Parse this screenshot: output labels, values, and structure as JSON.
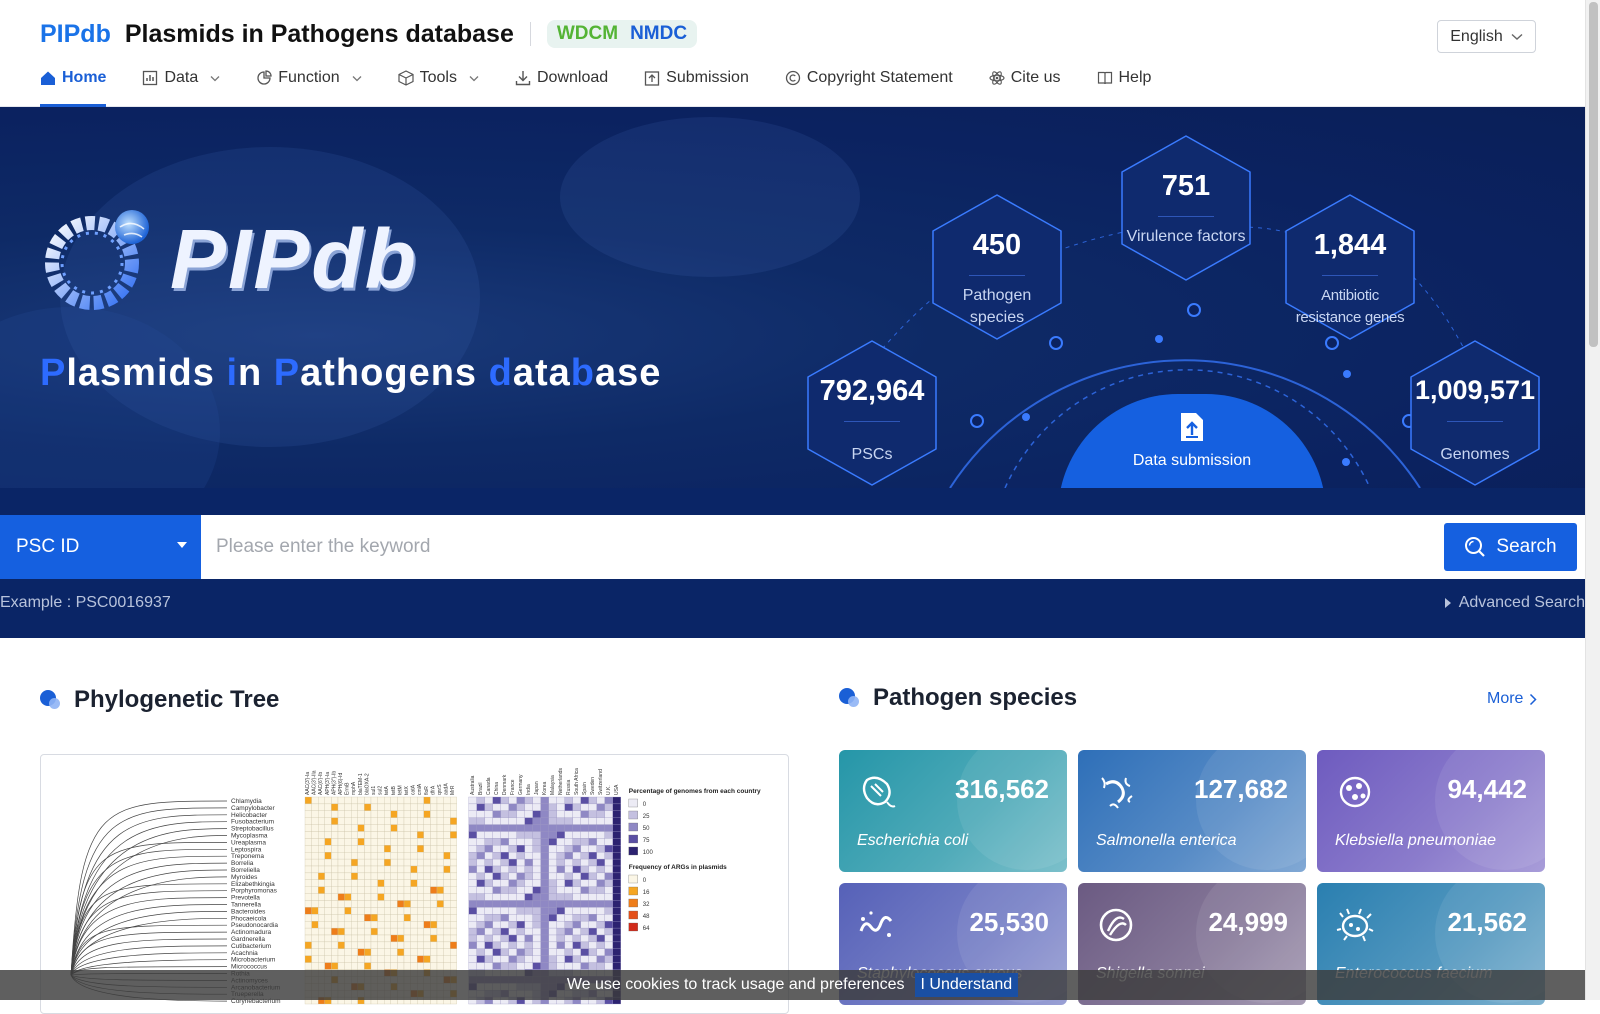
{
  "header": {
    "logo": "PIPdb",
    "title": "Plasmids in Pathogens database",
    "badge_wdcm": "WDCM",
    "badge_nmdc": "NMDC",
    "language": "English"
  },
  "nav": [
    {
      "label": "Home",
      "icon": "home-icon",
      "active": true
    },
    {
      "label": "Data",
      "icon": "chart-icon",
      "dropdown": true
    },
    {
      "label": "Function",
      "icon": "pie-icon",
      "dropdown": true
    },
    {
      "label": "Tools",
      "icon": "cube-icon",
      "dropdown": true
    },
    {
      "label": "Download",
      "icon": "download-icon"
    },
    {
      "label": "Submission",
      "icon": "upload-icon"
    },
    {
      "label": "Copyright Statement",
      "icon": "copyright-icon"
    },
    {
      "label": "Cite us",
      "icon": "atom-icon"
    },
    {
      "label": "Help",
      "icon": "book-icon"
    }
  ],
  "hero": {
    "logo_text": "PIPdb",
    "subtitle": {
      "p1": "P",
      "t1": "lasmids ",
      "p2": "i",
      "t2": "n ",
      "p3": "P",
      "t3": "athogens ",
      "p4": "d",
      "t4": "ata",
      "p5": "b",
      "t5": "ase"
    },
    "stats": {
      "pscs": {
        "value": "792,964",
        "label": "PSCs"
      },
      "pathogen_species": {
        "value": "450",
        "label": "Pathogen species"
      },
      "virulence": {
        "value": "751",
        "label": "Virulence factors"
      },
      "args": {
        "value": "1,844",
        "label": "Antibiotic resistance genes"
      },
      "genomes": {
        "value": "1,009,571",
        "label": "Genomes"
      }
    },
    "submission_label": "Data submission"
  },
  "search": {
    "selected_field": "PSC ID",
    "placeholder": "Please enter the keyword",
    "value": "",
    "button": "Search",
    "example": "Example : PSC0016937",
    "advanced": "Advanced Search"
  },
  "sections": {
    "tree_title": "Phylogenetic Tree",
    "species_title": "Pathogen species",
    "more": "More"
  },
  "tree": {
    "taxa": [
      "Chlamydia",
      "Campylobacter",
      "Helicobacter",
      "Fusobacterium",
      "Streptobacillus",
      "Mycoplasma",
      "Ureaplasma",
      "Leptospira",
      "Treponema",
      "Borrelia",
      "Borreliella",
      "Myroides",
      "Elizabethkingia",
      "Porphyromonas",
      "Prevotella",
      "Tannerella",
      "Bacteroides",
      "Phocaeicola",
      "Pseudonocardia",
      "Actinomadura",
      "Gardnerella",
      "Cutibacterium",
      "Acachnia",
      "Microbacterium",
      "Micrococcus",
      "Rothia",
      "Actinomyces",
      "Arcanobacterium",
      "Trueperella",
      "Corynebacterium"
    ],
    "arg_columns": [
      "AAC(3')-Ia",
      "AAC(3')-IIa",
      "AAC(6')-Ib",
      "APH(3')-Ia",
      "APH(3'')-Ib",
      "APH(6)-Id",
      "ErmB",
      "mphA",
      "blaTEM-1",
      "blaOXA-2",
      "sul1",
      "sul2",
      "tetA",
      "tetB",
      "tetM",
      "tetX",
      "catA",
      "cmlA",
      "floR",
      "dfrA",
      "qnrS",
      "aadA",
      "MrR"
    ],
    "country_columns": [
      "Australia",
      "Brazil",
      "Canada",
      "China",
      "Denmark",
      "France",
      "Germany",
      "India",
      "Japan",
      "Korea",
      "Malaysia",
      "Netherlands",
      "Russia",
      "South Africa",
      "Spain",
      "Sweden",
      "Switzerland",
      "U.K.",
      "USA"
    ],
    "legend_country_title": "Percentage of genomes from each country",
    "legend_country_values": [
      "0",
      "25",
      "50",
      "75",
      "100"
    ],
    "legend_country_colors": [
      "#ecebf5",
      "#c4c0e0",
      "#8f88c4",
      "#5a4fa3",
      "#2c2270"
    ],
    "legend_arg_title": "Frequency of ARGs in plasmids",
    "legend_arg_values": [
      "0",
      "16",
      "32",
      "48",
      "64"
    ],
    "legend_arg_colors": [
      "#fbf6e6",
      "#f5a623",
      "#ee7d1a",
      "#e4501a",
      "#d12a1a"
    ]
  },
  "species": [
    {
      "name": "Escherichia coli",
      "count": "316,562",
      "icon": "bacterium-icon",
      "color": "#2596a8"
    },
    {
      "name": "Salmonella enterica",
      "count": "127,682",
      "icon": "flagella-icon",
      "color": "#2e6fb8"
    },
    {
      "name": "Klebsiella pneumoniae",
      "count": "94,442",
      "icon": "coccus-cluster-icon",
      "color": "#6e5bbf"
    },
    {
      "name": "Staphylococcus aureus",
      "count": "25,530",
      "icon": "spirillum-icon",
      "color": "#5661b8"
    },
    {
      "name": "Shigella sonnei",
      "count": "24,999",
      "icon": "rod-icon",
      "color": "#6b5a82"
    },
    {
      "name": "Enterococcus faecium",
      "count": "21,562",
      "icon": "spiky-cell-icon",
      "color": "#2a7fb0"
    }
  ],
  "cookie": {
    "text": "We use cookies to track usage and preferences",
    "button": "I Understand"
  }
}
